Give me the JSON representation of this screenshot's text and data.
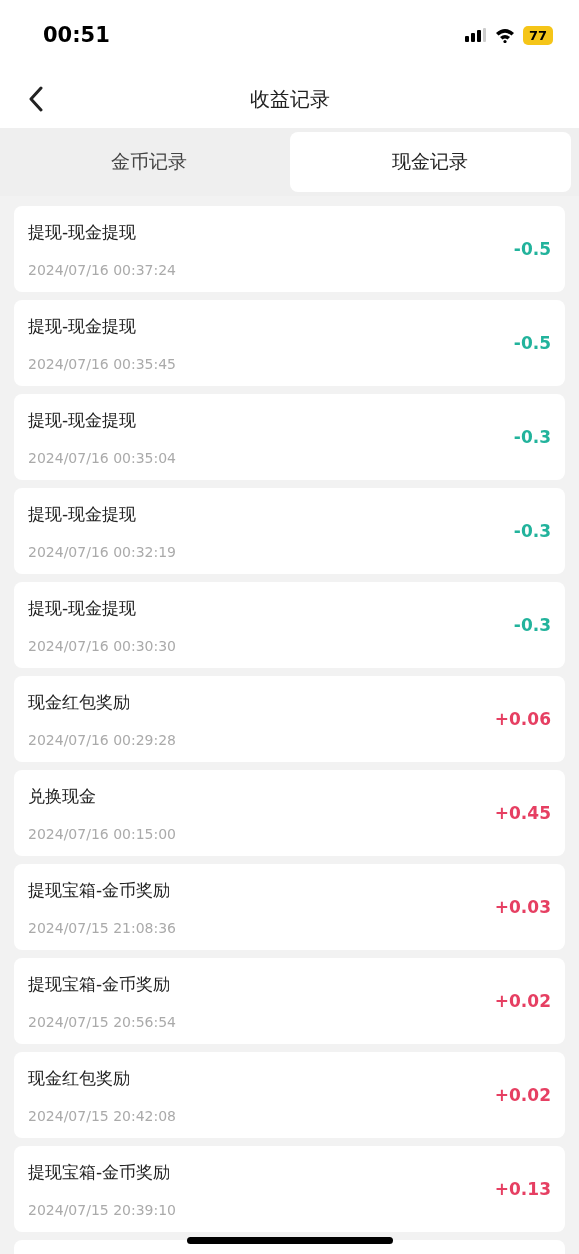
{
  "status_bar": {
    "time": "00:51",
    "battery": "77"
  },
  "header": {
    "title": "收益记录"
  },
  "tabs": [
    {
      "label": "金币记录",
      "selected": false
    },
    {
      "label": "现金记录",
      "selected": true
    }
  ],
  "records": [
    {
      "title": "提现-现金提现",
      "time": "2024/07/16 00:37:24",
      "amount": "-0.5",
      "kind": "debit"
    },
    {
      "title": "提现-现金提现",
      "time": "2024/07/16 00:35:45",
      "amount": "-0.5",
      "kind": "debit"
    },
    {
      "title": "提现-现金提现",
      "time": "2024/07/16 00:35:04",
      "amount": "-0.3",
      "kind": "debit"
    },
    {
      "title": "提现-现金提现",
      "time": "2024/07/16 00:32:19",
      "amount": "-0.3",
      "kind": "debit"
    },
    {
      "title": "提现-现金提现",
      "time": "2024/07/16 00:30:30",
      "amount": "-0.3",
      "kind": "debit"
    },
    {
      "title": "现金红包奖励",
      "time": "2024/07/16 00:29:28",
      "amount": "+0.06",
      "kind": "credit"
    },
    {
      "title": "兑换现金",
      "time": "2024/07/16 00:15:00",
      "amount": "+0.45",
      "kind": "credit"
    },
    {
      "title": "提现宝箱-金币奖励",
      "time": "2024/07/15 21:08:36",
      "amount": "+0.03",
      "kind": "credit"
    },
    {
      "title": "提现宝箱-金币奖励",
      "time": "2024/07/15 20:56:54",
      "amount": "+0.02",
      "kind": "credit"
    },
    {
      "title": "现金红包奖励",
      "time": "2024/07/15 20:42:08",
      "amount": "+0.02",
      "kind": "credit"
    },
    {
      "title": "提现宝箱-金币奖励",
      "time": "2024/07/15 20:39:10",
      "amount": "+0.13",
      "kind": "credit"
    }
  ]
}
